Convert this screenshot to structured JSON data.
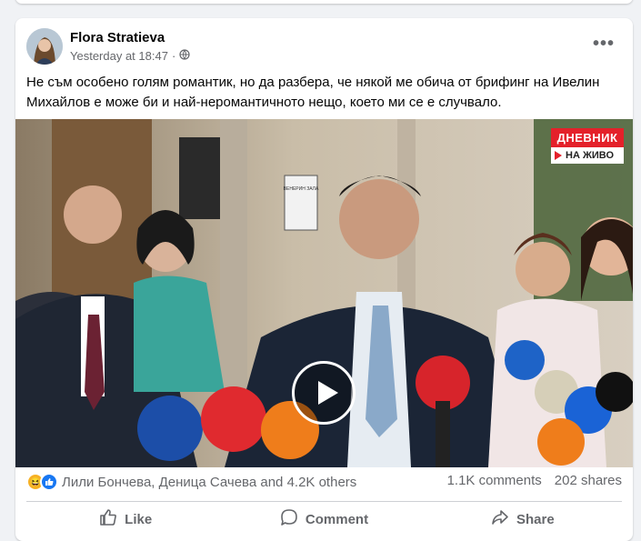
{
  "post": {
    "author": "Flora Stratieva",
    "timestamp": "Yesterday at 18:47",
    "separator": "·",
    "privacy_icon": "globe-icon",
    "text": "Не съм особено голям романтик, но да разбера, че някой ме обича от брифинг на Ивелин Михайлов е може би и най-неромантичното нещо, което ми се е случвало."
  },
  "video": {
    "channel_badge": "ДНЕВНИК",
    "live_label": "НА ЖИВО",
    "play_icon": "play-icon",
    "sign_text": "ВЕНЕРИН ЗАЛА"
  },
  "stats": {
    "reaction_icons": [
      "haha-icon",
      "like-icon"
    ],
    "reactors": "Лили Бончева, Деница Сачева and 4.2K others",
    "comments": "1.1K comments",
    "shares": "202 shares"
  },
  "actions": {
    "like": "Like",
    "comment": "Comment",
    "share": "Share"
  },
  "colors": {
    "background": "#f0f2f5",
    "card": "#ffffff",
    "secondary_text": "#65676b",
    "like_blue": "#1877f2",
    "badge_red": "#e4212a"
  }
}
